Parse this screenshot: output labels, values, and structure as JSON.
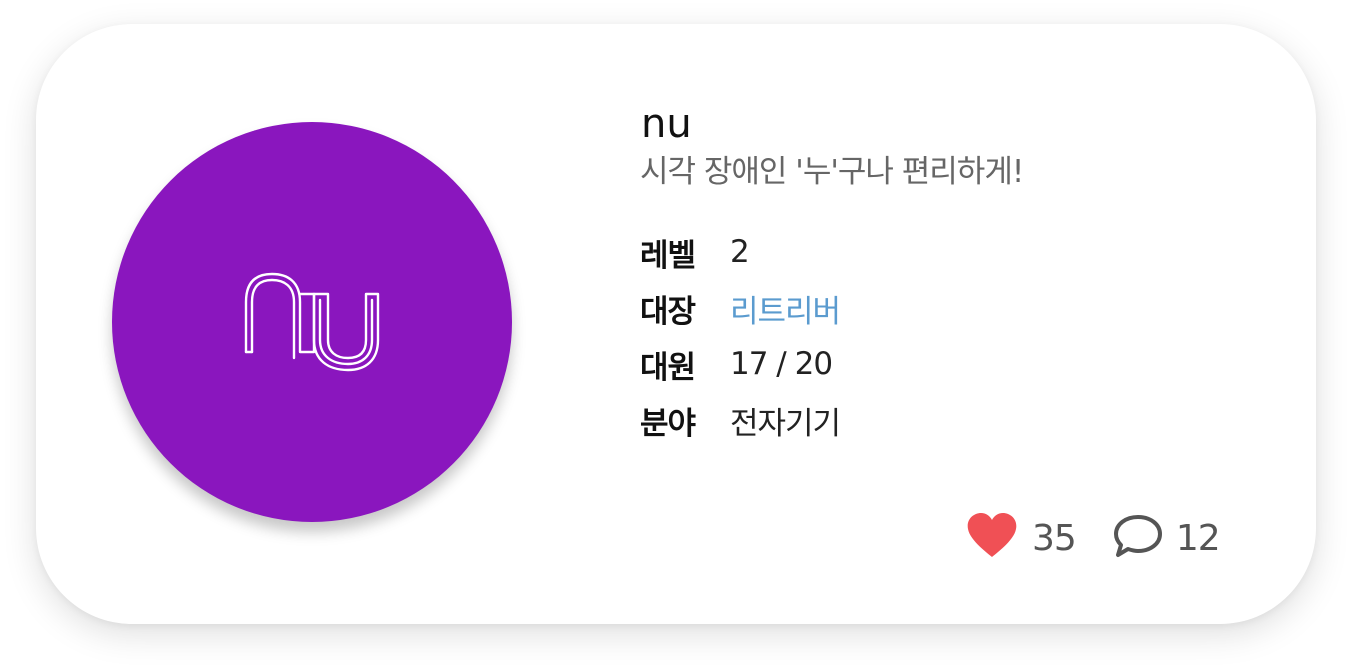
{
  "team": {
    "name": "nu",
    "tagline": "시각 장애인 '누'구나 편리하게!",
    "logo_text": "nu",
    "logo_color": "#8a16be"
  },
  "info": [
    {
      "label": "레벨",
      "value": "2"
    },
    {
      "label": "대장",
      "value": "리트리버"
    },
    {
      "label": "대원",
      "value": "17 / 20"
    },
    {
      "label": "분야",
      "value": "전자기기"
    }
  ],
  "stats": {
    "likes": "35",
    "comments": "12",
    "heart_color": "#f05055",
    "link_color": "#5b9bcf"
  },
  "icons": [
    "heart-icon",
    "comment-icon"
  ]
}
